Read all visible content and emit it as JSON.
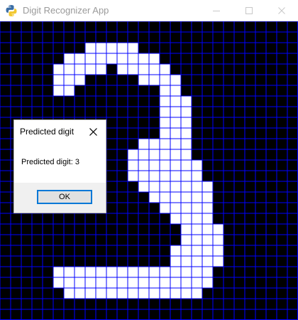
{
  "window": {
    "title": "Digit Recognizer App",
    "icon": "python-icon"
  },
  "controls": [
    "minimize-icon",
    "maximize-icon",
    "close-icon"
  ],
  "grid": {
    "rows": 28,
    "cols": 28,
    "background_color": "#000000",
    "line_color": "#0000ff",
    "filled_color": "#ffffff",
    "filled": [
      [
        2,
        8,
        12
      ],
      [
        3,
        6,
        14
      ],
      [
        4,
        5,
        9
      ],
      [
        4,
        11,
        15
      ],
      [
        5,
        5,
        7
      ],
      [
        5,
        13,
        16
      ],
      [
        6,
        5,
        6
      ],
      [
        6,
        15,
        16
      ],
      [
        7,
        15,
        17
      ],
      [
        8,
        15,
        17
      ],
      [
        9,
        15,
        17
      ],
      [
        10,
        15,
        17
      ],
      [
        11,
        13,
        17
      ],
      [
        12,
        12,
        17
      ],
      [
        13,
        12,
        18
      ],
      [
        14,
        12,
        18
      ],
      [
        15,
        13,
        19
      ],
      [
        16,
        14,
        19
      ],
      [
        17,
        15,
        19
      ],
      [
        18,
        16,
        19
      ],
      [
        19,
        17,
        20
      ],
      [
        20,
        17,
        20
      ],
      [
        21,
        16,
        20
      ],
      [
        22,
        16,
        20
      ],
      [
        23,
        5,
        19
      ],
      [
        24,
        5,
        19
      ],
      [
        25,
        6,
        18
      ]
    ]
  },
  "dialog": {
    "title": "Predicted digit",
    "message": "Predicted digit: 3",
    "ok_label": "OK"
  }
}
